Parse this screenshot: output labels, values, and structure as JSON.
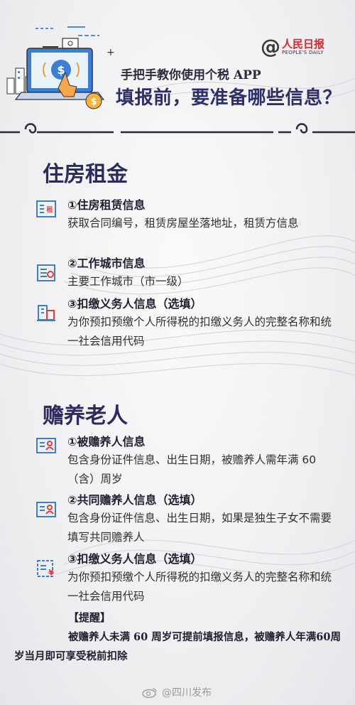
{
  "header": {
    "logo_cn": "人民日报",
    "logo_en": "PEOPLE'S DAILY",
    "subtitle": "手把手教你使用个税 APP",
    "title": "填报前，要准备哪些信息？"
  },
  "sections": [
    {
      "title": "住房租金",
      "items": [
        {
          "icon": "rent-contract-icon",
          "name": "①住房租赁信息",
          "desc": "获取合同编号，租赁房屋坐落地址，租赁方信息"
        },
        {
          "icon": "city-document-icon",
          "name": "②工作城市信息",
          "desc": "主要工作城市（市一级）"
        },
        {
          "icon": "building-icon",
          "name": "③扣缴义务人信息（选填）",
          "desc": "为你预扣预缴个人所得税的扣缴义务人的完整名称和统一社会信用代码"
        }
      ]
    },
    {
      "title": "赡养老人",
      "items": [
        {
          "icon": "id-card-icon",
          "name": "①被赡养人信息",
          "desc": "包含身份证件信息、出生日期，被赡养人需年满 60（含）周岁"
        },
        {
          "icon": "id-card-icon",
          "name": "②共同赡养人信息（选填）",
          "desc": "包含身份证件信息、出生日期，如果是独生子女不需要填写共同赡养人"
        },
        {
          "icon": "tax-receipt-icon",
          "name": "③扣缴义务人信息（选填）",
          "desc": "为你预扣预缴个人所得税的扣缴义务人的完整名称和统一社会信用代码"
        }
      ]
    }
  ],
  "reminder": {
    "title": "【提醒】",
    "text": "被赡养人未满 60 周岁可提前填报信息，被赡养人年满60周岁当月即可享受税前扣除"
  },
  "watermark": "@四川发布",
  "colors": {
    "accent_blue": "#3a7fd5",
    "title_navy": "#2e2e68",
    "brand_red": "#d8282b"
  }
}
